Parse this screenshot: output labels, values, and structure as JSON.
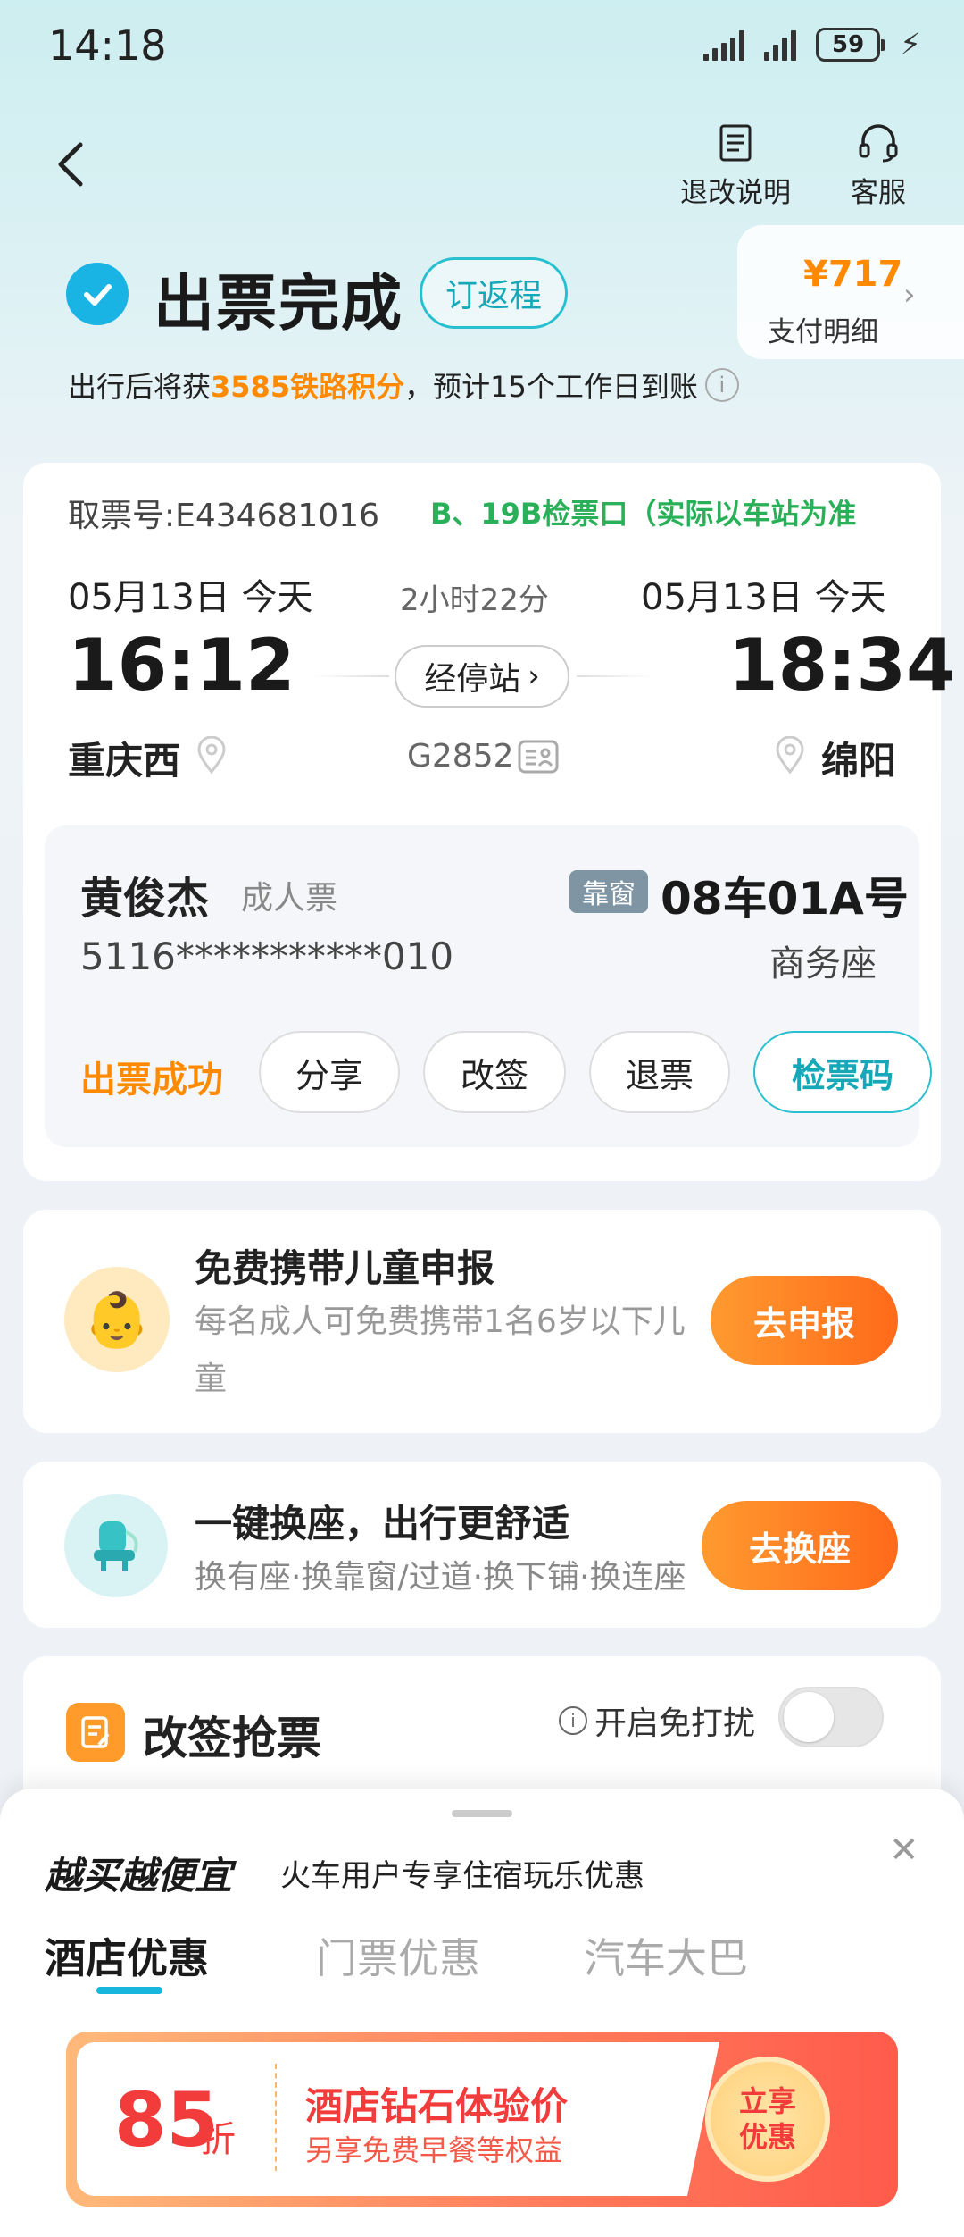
{
  "status_bar": {
    "time": "14:18",
    "battery": "59"
  },
  "nav": {
    "refund_label": "退改说明",
    "service_label": "客服"
  },
  "header": {
    "title": "出票完成",
    "return_button": "订返程",
    "pay_amount": "¥717",
    "pay_label": "支付明细",
    "points_prefix": "出行后将获",
    "points_highlight": "3585铁路积分",
    "points_suffix": "，预计15个工作日到账"
  },
  "ticket": {
    "ticket_no": "取票号:E434681016",
    "gate": "B、19B检票口（实际以车站为准",
    "dep_date": "05月13日 今天",
    "arr_date": "05月13日 今天",
    "duration": "2小时22分",
    "dep_time": "16:12",
    "arr_time": "18:34",
    "stops_button": "经停站",
    "dep_station": "重庆西",
    "arr_station": "绵阳",
    "train_no": "G2852",
    "passenger": {
      "name": "黄俊杰",
      "type": "成人票",
      "window_tag": "靠窗",
      "seat": "08车01A号",
      "id_no": "5116***********010",
      "seat_class": "商务座",
      "status": "出票成功"
    },
    "actions": {
      "share": "分享",
      "change": "改签",
      "refund": "退票",
      "check_code": "检票码"
    }
  },
  "child_card": {
    "title": "免费携带儿童申报",
    "desc": "每名成人可免费携带1名6岁以下儿童",
    "button": "去申报"
  },
  "seat_card": {
    "title": "一键换座，出行更舒适",
    "desc": "换有座·换靠窗/过道·换下铺·换连座",
    "button": "去换座"
  },
  "grab_card": {
    "title": "改签抢票",
    "dnd_label": "开启免打扰"
  },
  "sheet": {
    "title": "越买越便宜",
    "subtitle": "火车用户专享住宿玩乐优惠",
    "tabs": [
      "酒店优惠",
      "门票优惠",
      "汽车大巴"
    ],
    "promo": {
      "discount": "85",
      "discount_unit": "折",
      "title": "酒店钻石体验价",
      "desc": "另享免费早餐等权益",
      "cta": "立享优惠"
    }
  },
  "colors": {
    "accent": "#19b4e4",
    "orange": "#ff8a00",
    "green": "#2bb05a",
    "red": "#f23c3c"
  }
}
